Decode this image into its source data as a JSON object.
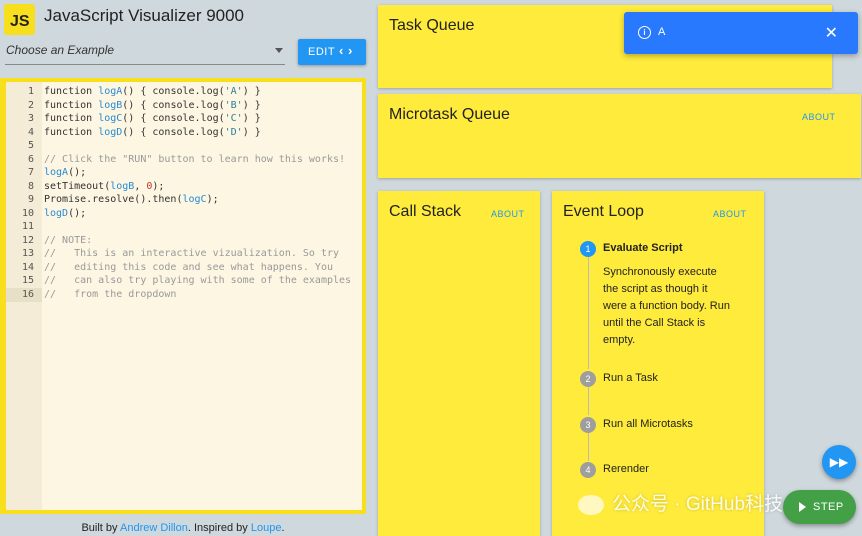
{
  "app": {
    "logo": "JS",
    "title": "JavaScript Visualizer 9000"
  },
  "example_select": {
    "value": "Choose an Example"
  },
  "edit_button": {
    "label": "EDIT",
    "icon": "code-icon"
  },
  "editor": {
    "lines": [
      {
        "n": "1",
        "code": "function logA() { console.log('A') }"
      },
      {
        "n": "2",
        "code": "function logB() { console.log('B') }"
      },
      {
        "n": "3",
        "code": "function logC() { console.log('C') }"
      },
      {
        "n": "4",
        "code": "function logD() { console.log('D') }"
      },
      {
        "n": "5",
        "code": ""
      },
      {
        "n": "6",
        "code": "// Click the \"RUN\" button to learn how this works!"
      },
      {
        "n": "7",
        "code": "logA();"
      },
      {
        "n": "8",
        "code": "setTimeout(logB, 0);"
      },
      {
        "n": "9",
        "code": "Promise.resolve().then(logC);"
      },
      {
        "n": "10",
        "code": "logD();"
      },
      {
        "n": "11",
        "code": ""
      },
      {
        "n": "12",
        "code": "// NOTE:"
      },
      {
        "n": "13",
        "code": "//   This is an interactive vizualization. So try"
      },
      {
        "n": "14",
        "code": "//   editing this code and see what happens. You"
      },
      {
        "n": "15",
        "code": "//   can also try playing with some of the examples"
      },
      {
        "n": "16",
        "code": "//   from the dropdown"
      }
    ],
    "active_line": "16"
  },
  "footer": {
    "prefix": "Built by ",
    "author": "Andrew Dillon",
    "middle": ". Inspired by ",
    "inspired": "Loupe",
    "suffix": "."
  },
  "panels": {
    "task_queue": {
      "title": "Task Queue"
    },
    "microtask_queue": {
      "title": "Microtask Queue",
      "about": "ABOUT"
    },
    "call_stack": {
      "title": "Call Stack",
      "about": "ABOUT"
    },
    "event_loop": {
      "title": "Event Loop",
      "about": "ABOUT",
      "steps": [
        {
          "n": "1",
          "label": "Evaluate Script",
          "desc": "Synchronously execute the script as though it were a function body. Run until the Call Stack is empty."
        },
        {
          "n": "2",
          "label": "Run a Task"
        },
        {
          "n": "3",
          "label": "Run all Microtasks"
        },
        {
          "n": "4",
          "label": "Rerender"
        }
      ]
    }
  },
  "toast": {
    "message": "A",
    "icon": "info-icon",
    "close_icon": "close-icon"
  },
  "controls": {
    "fast_forward_icon": "fast-forward-icon",
    "step_label": "STEP",
    "step_icon": "play-icon"
  },
  "watermark": "公众号 · GitHub科技",
  "colors": {
    "yellow": "#ffeb3b",
    "js_yellow": "#f7df1e",
    "blue": "#2196f3",
    "green": "#43a047"
  }
}
